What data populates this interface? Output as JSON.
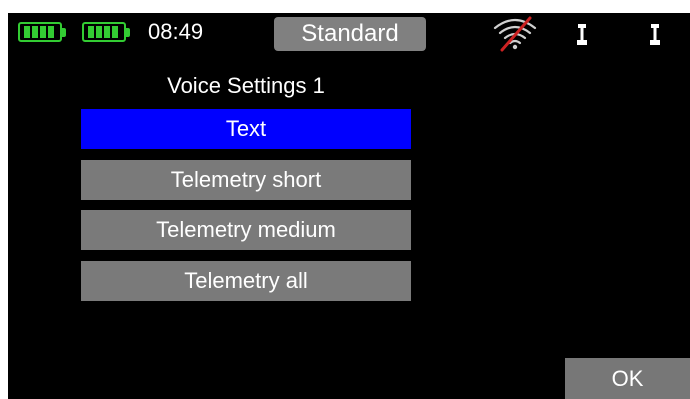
{
  "status_bar": {
    "batteries": [
      {
        "name": "receiver-battery-icon",
        "level": 1.0,
        "color": "#33cc33"
      },
      {
        "name": "transmitter-battery-icon",
        "level": 1.0,
        "color": "#33cc33"
      }
    ],
    "time": "08:49",
    "mode": "Standard",
    "signal_icon": "wifi-signal-off-icon",
    "stick_icons": [
      "stick-icon",
      "stick-icon"
    ]
  },
  "screen": {
    "title": "Voice Settings 1",
    "menu_items": [
      {
        "label": "Text",
        "selected": true
      },
      {
        "label": "Telemetry short",
        "selected": false
      },
      {
        "label": "Telemetry medium",
        "selected": false
      },
      {
        "label": "Telemetry all",
        "selected": false
      }
    ],
    "ok_label": "OK"
  },
  "colors": {
    "background": "#000000",
    "selected": "#0000ff",
    "item": "#7a7a7a",
    "accent_battery": "#33cc33",
    "signal_slash": "#cc2222"
  }
}
